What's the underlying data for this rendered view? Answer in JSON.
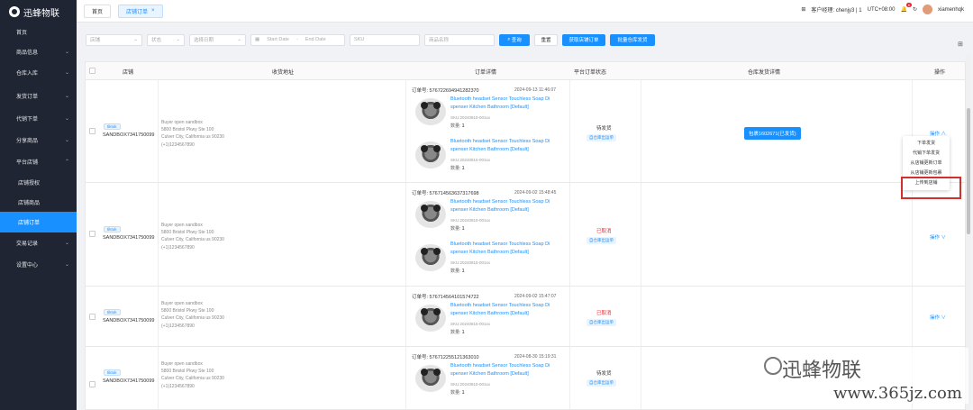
{
  "app": {
    "name": "迅蜂物联"
  },
  "sidebar": {
    "items": [
      {
        "label": "首页"
      },
      {
        "label": "商品信息"
      },
      {
        "label": "仓库入库"
      },
      {
        "label": "发货订单"
      },
      {
        "label": "代销下单"
      },
      {
        "label": "分享商品"
      },
      {
        "label": "平台店铺"
      },
      {
        "label": "店铺授权"
      },
      {
        "label": "店铺商品"
      },
      {
        "label": "店铺订单"
      },
      {
        "label": "交易记录"
      },
      {
        "label": "设置中心"
      }
    ]
  },
  "tabs": [
    {
      "label": "首页"
    },
    {
      "label": "店铺订单"
    }
  ],
  "header": {
    "customer": "客户经理: chenjy3 | 1",
    "timezone": "UTC+08:00",
    "badge": "6",
    "username": "xiamenhqk"
  },
  "filters": {
    "shop": "店铺",
    "status": "状态",
    "date_type": "选择日期",
    "start": "Start Date",
    "sep": "-",
    "end": "End Date",
    "sku": "SKU",
    "product": "商品名称",
    "search": "查询",
    "reset": "重置",
    "fetch": "获取店铺订单",
    "batch": "批量仓库发货"
  },
  "table": {
    "headers": [
      "店铺",
      "收货地址",
      "订单详情",
      "平台订单状态",
      "仓库发货详情",
      "操作"
    ]
  },
  "rows": [
    {
      "shop_tag": "tiktok",
      "shop_id": "SANDBOX7341750099",
      "addr": [
        "Buyer open sandbox",
        "5800 Bristol Pkwy Ste 100",
        "Culver City, California   us   90230",
        "(+1)1234567890"
      ],
      "order_no": "订单号: 576722694941282370",
      "order_time": "2024-09-13 11:46:07",
      "products": [
        {
          "title": "Bluetooth headset Sensor Touchless Soap Di spenser Kitchen Bathroom  [Default]",
          "sku": "SKU:20240815-001xx",
          "qty_label": "数量:",
          "qty": "1"
        },
        {
          "title": "Bluetooth headset Sensor Touchless Soap Di spenser Kitchen Bathroom  [Default]",
          "sku": "SKU:20240815-001xx",
          "qty_label": "数量:",
          "qty": "1"
        }
      ],
      "status": "待发货",
      "status_tag": "自仓库出运单",
      "package": "包裹1602671(已发货)",
      "op": "操作 ∧"
    },
    {
      "shop_tag": "tiktok",
      "shop_id": "SANDBOX7341750099",
      "addr": [
        "Buyer open sandbox",
        "5800 Bristol Pkwy Ste 100",
        "Culver City, California   us   90230",
        "(+1)1234567890"
      ],
      "order_no": "订单号: 576714563637317698",
      "order_time": "2024-09-02 15:48:45",
      "products": [
        {
          "title": "Bluetooth headset Sensor Touchless Soap Di spenser Kitchen Bathroom  [Default]",
          "sku": "SKU:20240815-001xx",
          "qty_label": "数量:",
          "qty": "1"
        },
        {
          "title": "Bluetooth headset Sensor Touchless Soap Di spenser Kitchen Bathroom  [Default]",
          "sku": "SKU:20240815-001xx",
          "qty_label": "数量:",
          "qty": "1"
        }
      ],
      "status": "已取消",
      "status_tag": "自仓库出运单",
      "op": "操作 ∨"
    },
    {
      "shop_tag": "tiktok",
      "shop_id": "SANDBOX7341750099",
      "addr": [
        "Buyer open sandbox",
        "5800 Bristol Pkwy Ste 100",
        "Culver City, California   us   90230",
        "(+1)1234567890"
      ],
      "order_no": "订单号: 576714564101574722",
      "order_time": "2024-09-02 15:47:07",
      "products": [
        {
          "title": "Bluetooth headset Sensor Touchless Soap Di spenser Kitchen Bathroom  [Default]",
          "sku": "SKU:20240815-001xx",
          "qty_label": "数量:",
          "qty": "1"
        }
      ],
      "status": "已取消",
      "status_tag": "自仓库出运单",
      "op": "操作 ∨"
    },
    {
      "shop_tag": "tiktok",
      "shop_id": "SANDBOX7341750099",
      "addr": [
        "Buyer open sandbox",
        "5800 Bristol Pkwy Ste 100",
        "Culver City, California   us   90230",
        "(+1)1234567890"
      ],
      "order_no": "订单号: 576712255121363010",
      "order_time": "2024-08-30 15:19:31",
      "products": [
        {
          "title": "Bluetooth headset Sensor Touchless Soap Di spenser Kitchen Bathroom  [Default]",
          "sku": "SKU:20240815-001xx",
          "qty_label": "数量:",
          "qty": "1"
        }
      ],
      "status": "待发货",
      "status_tag": "自仓库出运单",
      "op": ""
    }
  ],
  "dropdown": {
    "items": [
      "下单发货",
      "代销下单发货",
      "从店铺更新订单",
      "从店铺更新包裹",
      "上传到店铺"
    ]
  },
  "watermark": {
    "line1": "迅蜂物联",
    "line2": "www.365jz.com"
  }
}
